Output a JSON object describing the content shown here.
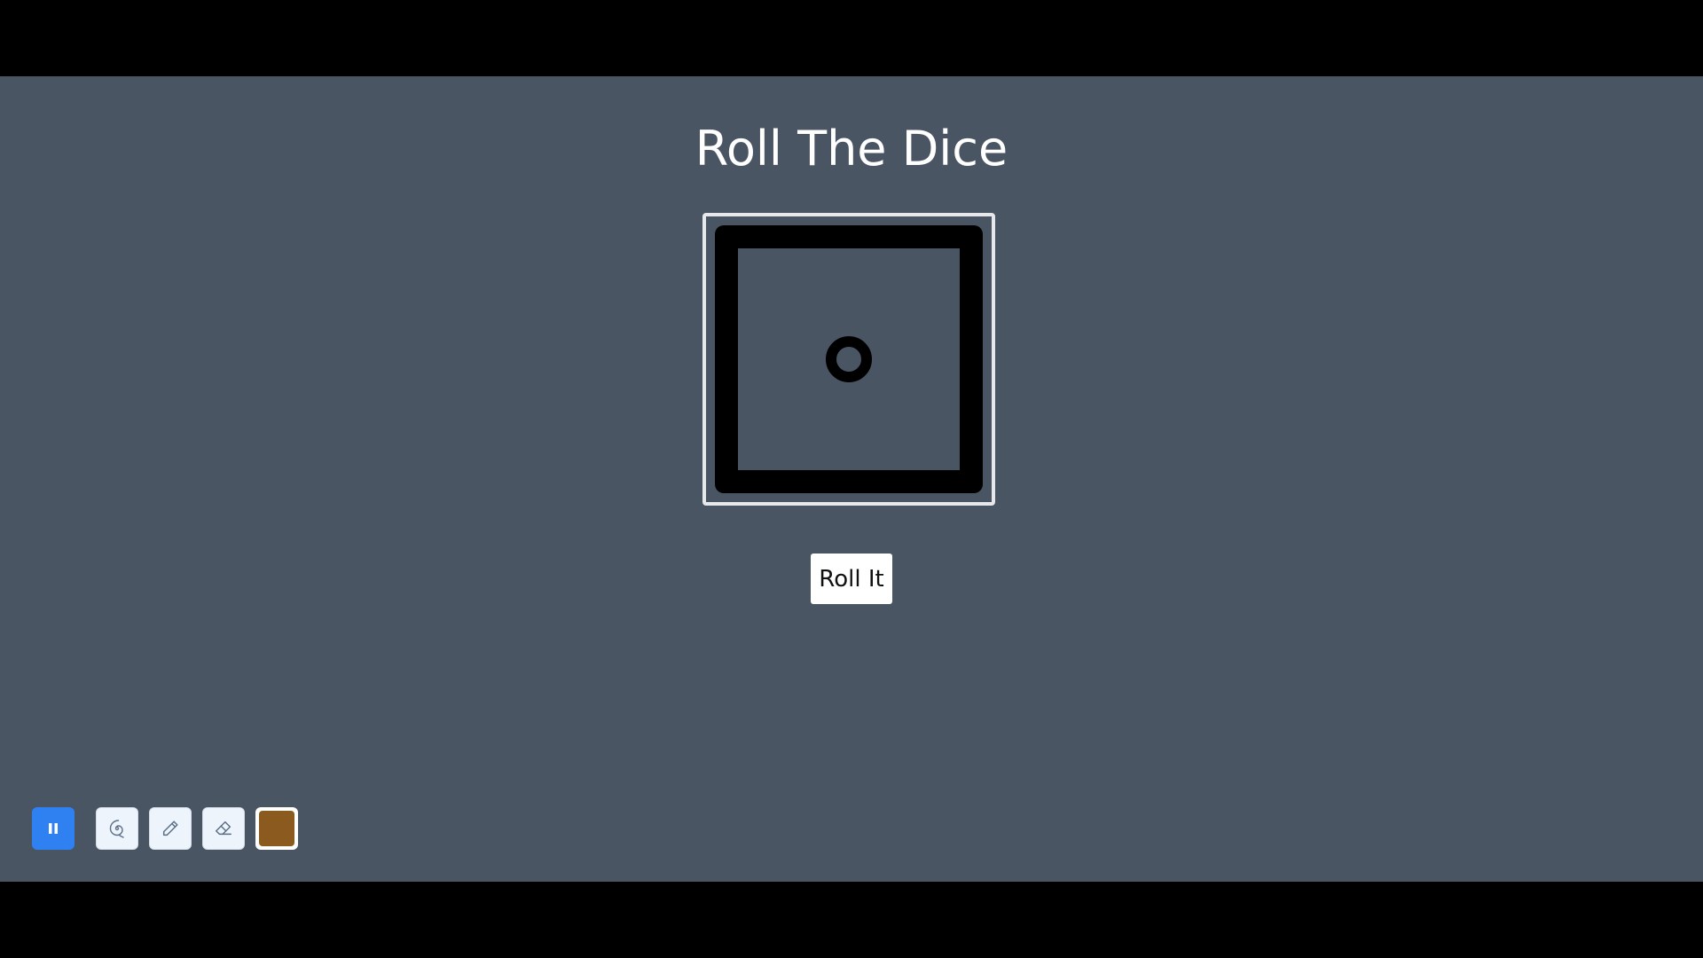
{
  "app": {
    "title": "Roll The Dice"
  },
  "dice": {
    "face_value": 1
  },
  "controls": {
    "roll_label": "Roll It"
  },
  "toolbar": {
    "tools": [
      {
        "name": "pause",
        "icon": "pause-icon",
        "active": true
      },
      {
        "name": "spiral",
        "icon": "spiral-icon"
      },
      {
        "name": "pen",
        "icon": "pencil-icon"
      },
      {
        "name": "eraser",
        "icon": "eraser-icon"
      },
      {
        "name": "color",
        "icon": "color-swatch"
      }
    ],
    "selected_color": "#8b5a1e"
  },
  "colors": {
    "background": "#4a5563",
    "accent": "#2f80f0",
    "dice": "#000000",
    "frame": "#e6e8ec"
  }
}
